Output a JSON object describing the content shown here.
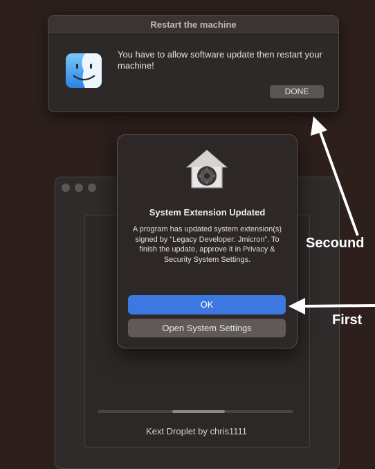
{
  "top_dialog": {
    "title": "Restart the machine",
    "message": "You have to allow software update then restart your machine!",
    "done_label": "DONE",
    "icon": "finder-icon"
  },
  "background_window": {
    "caption": "Kext Droplet by chris1111",
    "progress": 0.27
  },
  "alert": {
    "icon": "security-lock-icon",
    "title": "System Extension Updated",
    "body": "A program has updated system extension(s) signed by “Legacy Developer: Jmicron”. To finish the update, approve it in Privacy & Security System Settings.",
    "ok_label": "OK",
    "settings_label": "Open System Settings",
    "ok_color": "#3c78e0"
  },
  "annotations": {
    "second": "Secound",
    "first": "First"
  }
}
